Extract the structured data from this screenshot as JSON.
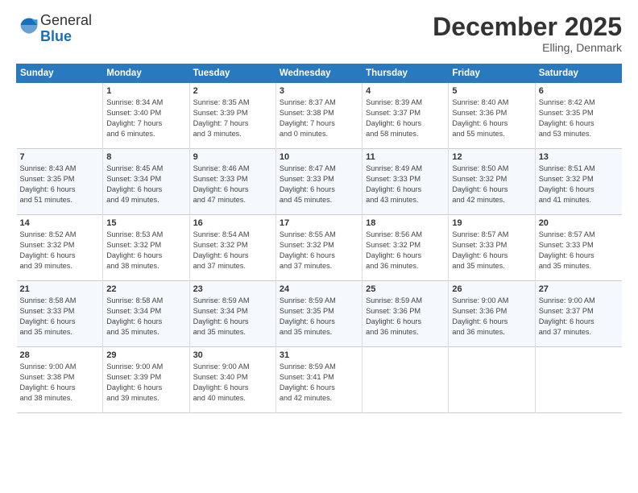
{
  "logo": {
    "general": "General",
    "blue": "Blue"
  },
  "header": {
    "month": "December 2025",
    "location": "Elling, Denmark"
  },
  "columns": [
    "Sunday",
    "Monday",
    "Tuesday",
    "Wednesday",
    "Thursday",
    "Friday",
    "Saturday"
  ],
  "weeks": [
    [
      {
        "day": "",
        "content": ""
      },
      {
        "day": "1",
        "content": "Sunrise: 8:34 AM\nSunset: 3:40 PM\nDaylight: 7 hours\nand 6 minutes."
      },
      {
        "day": "2",
        "content": "Sunrise: 8:35 AM\nSunset: 3:39 PM\nDaylight: 7 hours\nand 3 minutes."
      },
      {
        "day": "3",
        "content": "Sunrise: 8:37 AM\nSunset: 3:38 PM\nDaylight: 7 hours\nand 0 minutes."
      },
      {
        "day": "4",
        "content": "Sunrise: 8:39 AM\nSunset: 3:37 PM\nDaylight: 6 hours\nand 58 minutes."
      },
      {
        "day": "5",
        "content": "Sunrise: 8:40 AM\nSunset: 3:36 PM\nDaylight: 6 hours\nand 55 minutes."
      },
      {
        "day": "6",
        "content": "Sunrise: 8:42 AM\nSunset: 3:35 PM\nDaylight: 6 hours\nand 53 minutes."
      }
    ],
    [
      {
        "day": "7",
        "content": "Sunrise: 8:43 AM\nSunset: 3:35 PM\nDaylight: 6 hours\nand 51 minutes."
      },
      {
        "day": "8",
        "content": "Sunrise: 8:45 AM\nSunset: 3:34 PM\nDaylight: 6 hours\nand 49 minutes."
      },
      {
        "day": "9",
        "content": "Sunrise: 8:46 AM\nSunset: 3:33 PM\nDaylight: 6 hours\nand 47 minutes."
      },
      {
        "day": "10",
        "content": "Sunrise: 8:47 AM\nSunset: 3:33 PM\nDaylight: 6 hours\nand 45 minutes."
      },
      {
        "day": "11",
        "content": "Sunrise: 8:49 AM\nSunset: 3:33 PM\nDaylight: 6 hours\nand 43 minutes."
      },
      {
        "day": "12",
        "content": "Sunrise: 8:50 AM\nSunset: 3:32 PM\nDaylight: 6 hours\nand 42 minutes."
      },
      {
        "day": "13",
        "content": "Sunrise: 8:51 AM\nSunset: 3:32 PM\nDaylight: 6 hours\nand 41 minutes."
      }
    ],
    [
      {
        "day": "14",
        "content": "Sunrise: 8:52 AM\nSunset: 3:32 PM\nDaylight: 6 hours\nand 39 minutes."
      },
      {
        "day": "15",
        "content": "Sunrise: 8:53 AM\nSunset: 3:32 PM\nDaylight: 6 hours\nand 38 minutes."
      },
      {
        "day": "16",
        "content": "Sunrise: 8:54 AM\nSunset: 3:32 PM\nDaylight: 6 hours\nand 37 minutes."
      },
      {
        "day": "17",
        "content": "Sunrise: 8:55 AM\nSunset: 3:32 PM\nDaylight: 6 hours\nand 37 minutes."
      },
      {
        "day": "18",
        "content": "Sunrise: 8:56 AM\nSunset: 3:32 PM\nDaylight: 6 hours\nand 36 minutes."
      },
      {
        "day": "19",
        "content": "Sunrise: 8:57 AM\nSunset: 3:33 PM\nDaylight: 6 hours\nand 35 minutes."
      },
      {
        "day": "20",
        "content": "Sunrise: 8:57 AM\nSunset: 3:33 PM\nDaylight: 6 hours\nand 35 minutes."
      }
    ],
    [
      {
        "day": "21",
        "content": "Sunrise: 8:58 AM\nSunset: 3:33 PM\nDaylight: 6 hours\nand 35 minutes."
      },
      {
        "day": "22",
        "content": "Sunrise: 8:58 AM\nSunset: 3:34 PM\nDaylight: 6 hours\nand 35 minutes."
      },
      {
        "day": "23",
        "content": "Sunrise: 8:59 AM\nSunset: 3:34 PM\nDaylight: 6 hours\nand 35 minutes."
      },
      {
        "day": "24",
        "content": "Sunrise: 8:59 AM\nSunset: 3:35 PM\nDaylight: 6 hours\nand 35 minutes."
      },
      {
        "day": "25",
        "content": "Sunrise: 8:59 AM\nSunset: 3:36 PM\nDaylight: 6 hours\nand 36 minutes."
      },
      {
        "day": "26",
        "content": "Sunrise: 9:00 AM\nSunset: 3:36 PM\nDaylight: 6 hours\nand 36 minutes."
      },
      {
        "day": "27",
        "content": "Sunrise: 9:00 AM\nSunset: 3:37 PM\nDaylight: 6 hours\nand 37 minutes."
      }
    ],
    [
      {
        "day": "28",
        "content": "Sunrise: 9:00 AM\nSunset: 3:38 PM\nDaylight: 6 hours\nand 38 minutes."
      },
      {
        "day": "29",
        "content": "Sunrise: 9:00 AM\nSunset: 3:39 PM\nDaylight: 6 hours\nand 39 minutes."
      },
      {
        "day": "30",
        "content": "Sunrise: 9:00 AM\nSunset: 3:40 PM\nDaylight: 6 hours\nand 40 minutes."
      },
      {
        "day": "31",
        "content": "Sunrise: 8:59 AM\nSunset: 3:41 PM\nDaylight: 6 hours\nand 42 minutes."
      },
      {
        "day": "",
        "content": ""
      },
      {
        "day": "",
        "content": ""
      },
      {
        "day": "",
        "content": ""
      }
    ]
  ]
}
